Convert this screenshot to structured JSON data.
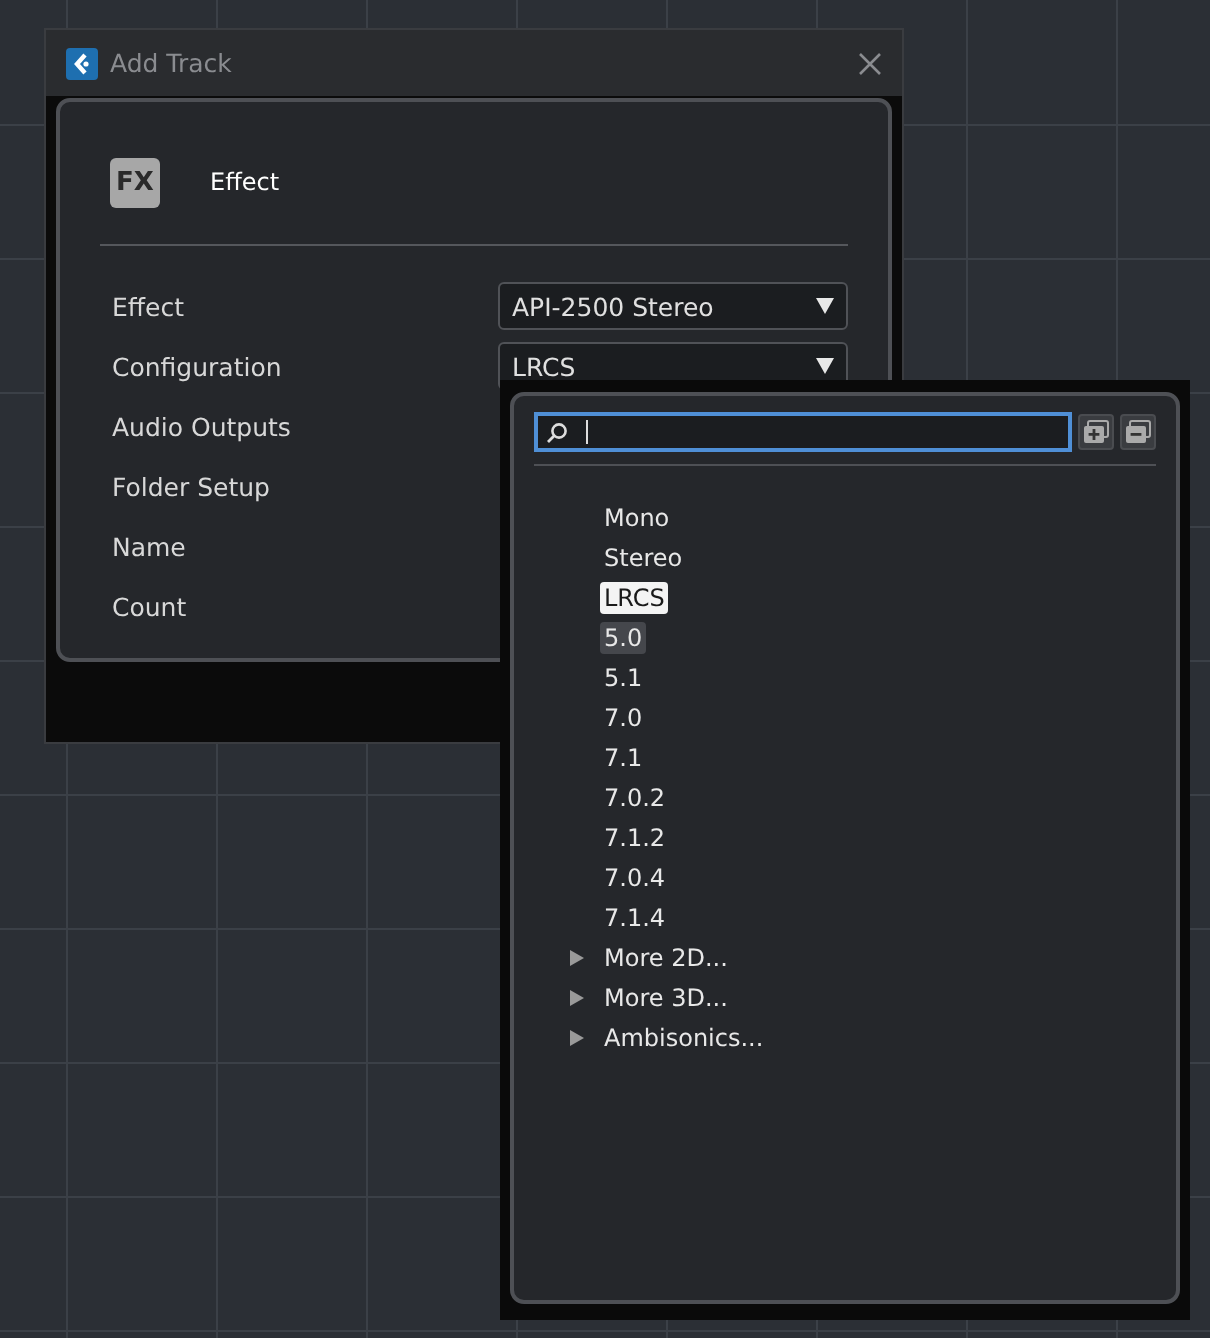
{
  "window": {
    "title": "Add Track"
  },
  "track_type": {
    "icon_text": "FX",
    "label": "Effect"
  },
  "fields": [
    {
      "label": "Effect",
      "value": "API-2500 Stereo",
      "kind": "dropdown"
    },
    {
      "label": "Configuration",
      "value": "LRCS",
      "kind": "dropdown"
    },
    {
      "label": "Audio Outputs"
    },
    {
      "label": "Folder Setup"
    },
    {
      "label": "Name"
    },
    {
      "label": "Count"
    }
  ],
  "popup": {
    "items": [
      {
        "label": "Mono",
        "kind": "option",
        "selected": false,
        "highlighted": false
      },
      {
        "label": "Stereo",
        "kind": "option",
        "selected": false,
        "highlighted": false
      },
      {
        "label": "LRCS",
        "kind": "option",
        "selected": true,
        "highlighted": false
      },
      {
        "label": "5.0",
        "kind": "option",
        "selected": false,
        "highlighted": true
      },
      {
        "label": "5.1",
        "kind": "option",
        "selected": false,
        "highlighted": false
      },
      {
        "label": "7.0",
        "kind": "option",
        "selected": false,
        "highlighted": false
      },
      {
        "label": "7.1",
        "kind": "option",
        "selected": false,
        "highlighted": false
      },
      {
        "label": "7.0.2",
        "kind": "option",
        "selected": false,
        "highlighted": false
      },
      {
        "label": "7.1.2",
        "kind": "option",
        "selected": false,
        "highlighted": false
      },
      {
        "label": "7.0.4",
        "kind": "option",
        "selected": false,
        "highlighted": false
      },
      {
        "label": "7.1.4",
        "kind": "option",
        "selected": false,
        "highlighted": false
      },
      {
        "label": "More 2D...",
        "kind": "submenu",
        "selected": false,
        "highlighted": false
      },
      {
        "label": "More 3D...",
        "kind": "submenu",
        "selected": false,
        "highlighted": false
      },
      {
        "label": "Ambisonics...",
        "kind": "submenu",
        "selected": false,
        "highlighted": false
      }
    ]
  }
}
